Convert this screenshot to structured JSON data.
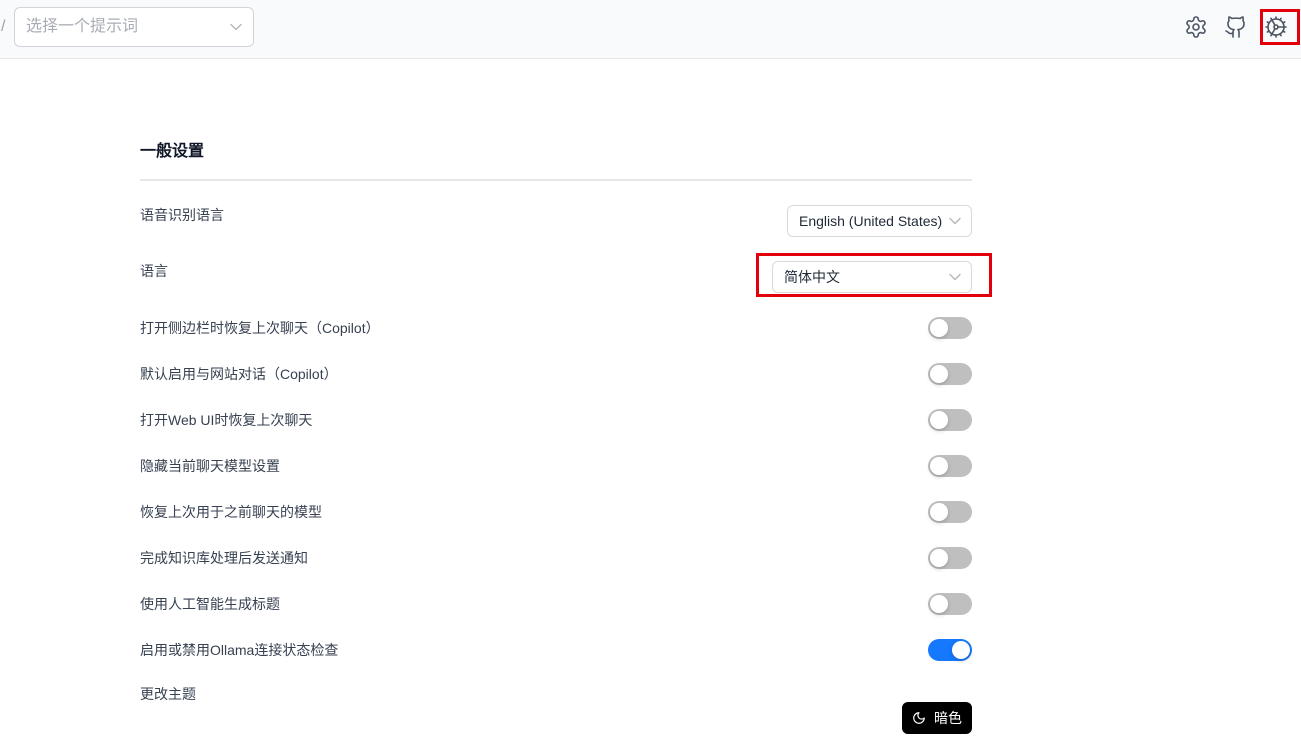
{
  "colors": {
    "accent": "#1677ff",
    "toggle_off": "#bfbfbf",
    "highlight": "#e3000b",
    "theme_button": "#000000"
  },
  "header": {
    "separator": "/",
    "prompt_select": {
      "placeholder": "选择一个提示词",
      "icon": "chevron-down-icon"
    },
    "icons": [
      "gear-icon",
      "github-icon",
      "cog-icon"
    ]
  },
  "settings": {
    "title": "一般设置",
    "speech_language": {
      "label": "语音识别语言",
      "value": "English (United States)",
      "icon": "chevron-down-icon"
    },
    "language": {
      "label": "语言",
      "value": "简体中文",
      "icon": "chevron-down-icon"
    },
    "toggles": [
      {
        "label": "打开侧边栏时恢复上次聊天（Copilot）",
        "enabled": false
      },
      {
        "label": "默认启用与网站对话（Copilot）",
        "enabled": false
      },
      {
        "label": "打开Web UI时恢复上次聊天",
        "enabled": false
      },
      {
        "label": "隐藏当前聊天模型设置",
        "enabled": false
      },
      {
        "label": "恢复上次用于之前聊天的模型",
        "enabled": false
      },
      {
        "label": "完成知识库处理后发送通知",
        "enabled": false
      },
      {
        "label": "使用人工智能生成标题",
        "enabled": false
      },
      {
        "label": "启用或禁用Ollama连接状态检查",
        "enabled": true
      }
    ],
    "theme": {
      "label": "更改主题",
      "button_label": "暗色",
      "icon": "moon-icon"
    }
  }
}
